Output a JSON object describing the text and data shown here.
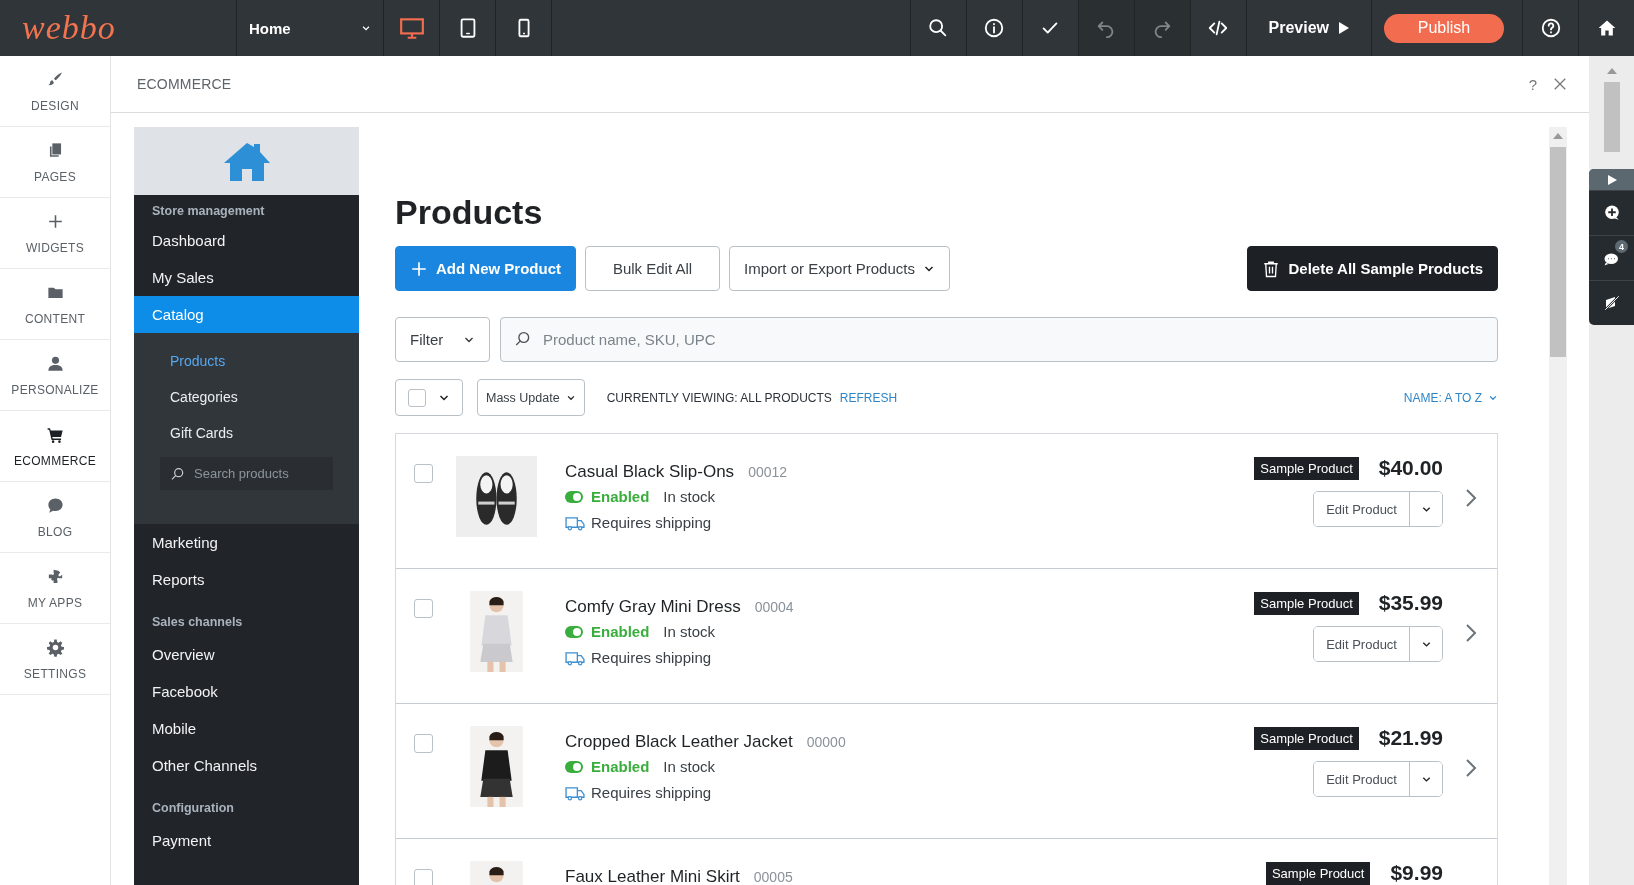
{
  "topbar": {
    "logo": "webbo",
    "page_select": "Home",
    "devices": [
      {
        "kind": "desktop",
        "selected": true
      },
      {
        "kind": "tablet",
        "selected": false
      },
      {
        "kind": "phone",
        "selected": false
      }
    ],
    "tools": [
      {
        "kind": "search",
        "disabled": false
      },
      {
        "kind": "info",
        "disabled": false
      },
      {
        "kind": "check",
        "disabled": false
      },
      {
        "kind": "undo",
        "disabled": true
      },
      {
        "kind": "redo",
        "disabled": true
      },
      {
        "kind": "code",
        "disabled": false
      }
    ],
    "preview": "Preview",
    "publish": "Publish"
  },
  "rail": [
    {
      "kind": "design",
      "label": "DESIGN",
      "selected": false
    },
    {
      "kind": "pages",
      "label": "PAGES",
      "selected": false
    },
    {
      "kind": "widgets",
      "label": "WIDGETS",
      "selected": false
    },
    {
      "kind": "content",
      "label": "CONTENT",
      "selected": false
    },
    {
      "kind": "personalize",
      "label": "PERSONALIZE",
      "selected": false
    },
    {
      "kind": "ecommerce",
      "label": "ECOMMERCE",
      "selected": true
    },
    {
      "kind": "blog",
      "label": "BLOG",
      "selected": false
    },
    {
      "kind": "apps",
      "label": "MY APPS",
      "selected": false
    },
    {
      "kind": "settings",
      "label": "SETTINGS",
      "selected": false
    }
  ],
  "panel": {
    "title": "ECOMMERCE",
    "help": "?"
  },
  "store_nav": [
    {
      "kind": "heading",
      "label": "Store management"
    },
    {
      "kind": "item",
      "label": "Dashboard",
      "selected": false
    },
    {
      "kind": "item",
      "label": "My Sales",
      "selected": false
    },
    {
      "kind": "item",
      "label": "Catalog",
      "selected": true,
      "search_placeholder": "Search products",
      "children": [
        {
          "label": "Products",
          "selected": true
        },
        {
          "label": "Categories",
          "selected": false
        },
        {
          "label": "Gift Cards",
          "selected": false
        }
      ]
    },
    {
      "kind": "item",
      "label": "Marketing",
      "selected": false
    },
    {
      "kind": "item",
      "label": "Reports",
      "selected": false
    },
    {
      "kind": "heading",
      "label": "Sales channels"
    },
    {
      "kind": "item",
      "label": "Overview",
      "selected": false
    },
    {
      "kind": "item",
      "label": "Facebook",
      "selected": false
    },
    {
      "kind": "item",
      "label": "Mobile",
      "selected": false
    },
    {
      "kind": "item",
      "label": "Other Channels",
      "selected": false
    },
    {
      "kind": "heading",
      "label": "Configuration"
    },
    {
      "kind": "item",
      "label": "Payment",
      "selected": false
    }
  ],
  "main": {
    "title": "Products",
    "add_button": "Add New Product",
    "bulk_button": "Bulk Edit All",
    "import_button": "Import or Export Products",
    "delete_button": "Delete All Sample Products",
    "filter": "Filter",
    "search_placeholder": "Product name, SKU, UPC",
    "select_all_checked": false,
    "mass_update": "Mass Update",
    "viewing": "CURRENTLY VIEWING: ALL PRODUCTS",
    "refresh": "REFRESH",
    "sort": "NAME: A TO Z"
  },
  "products": [
    {
      "checked": false,
      "name": "Casual Black Slip-Ons",
      "sku": "00012",
      "enabled": true,
      "status": "Enabled",
      "stock": "In stock",
      "shipping": "Requires shipping",
      "badge": "Sample Product",
      "price": "$40.00",
      "action": "Edit Product"
    },
    {
      "checked": false,
      "name": "Comfy Gray Mini Dress",
      "sku": "00004",
      "enabled": true,
      "status": "Enabled",
      "stock": "In stock",
      "shipping": "Requires shipping",
      "badge": "Sample Product",
      "price": "$35.99",
      "action": "Edit Product"
    },
    {
      "checked": false,
      "name": "Cropped Black Leather Jacket",
      "sku": "00000",
      "enabled": true,
      "status": "Enabled",
      "stock": "In stock",
      "shipping": "Requires shipping",
      "badge": "Sample Product",
      "price": "$21.99",
      "action": "Edit Product"
    },
    {
      "checked": false,
      "name": "Faux Leather Mini Skirt",
      "sku": "00005",
      "badge": "Sample Product",
      "price": "$9.99"
    }
  ],
  "float_toolbar": {
    "comment_count": "4"
  }
}
